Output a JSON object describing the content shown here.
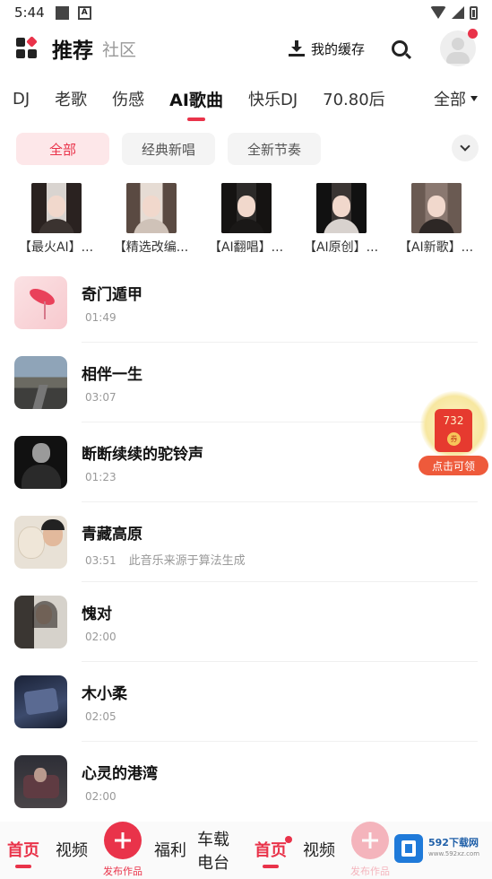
{
  "status_bar": {
    "time": "5:44"
  },
  "header": {
    "title": "推荐",
    "subtitle": "社区",
    "cache_label": "我的缓存"
  },
  "categories": {
    "tabs": [
      {
        "label": "DJ",
        "active": false
      },
      {
        "label": "老歌",
        "active": false
      },
      {
        "label": "伤感",
        "active": false
      },
      {
        "label": "AI歌曲",
        "active": true
      },
      {
        "label": "快乐DJ",
        "active": false
      },
      {
        "label": "70.80后",
        "active": false
      }
    ],
    "all_label": "全部"
  },
  "sub_tabs": [
    {
      "label": "全部",
      "active": true
    },
    {
      "label": "经典新唱",
      "active": false
    },
    {
      "label": "全新节奏",
      "active": false
    }
  ],
  "playlists": [
    {
      "name": "【最火AI】..."
    },
    {
      "name": "【精选改编..."
    },
    {
      "name": "【AI翻唱】..."
    },
    {
      "name": "【AI原创】..."
    },
    {
      "name": "【AI新歌】..."
    }
  ],
  "songs": [
    {
      "title": "奇门遁甲",
      "duration": "01:49",
      "note": ""
    },
    {
      "title": "相伴一生",
      "duration": "03:07",
      "note": ""
    },
    {
      "title": "断断续续的驼铃声",
      "duration": "01:23",
      "note": ""
    },
    {
      "title": "青藏高原",
      "duration": "03:51",
      "note": "此音乐来源于算法生成"
    },
    {
      "title": "愧对",
      "duration": "02:00",
      "note": ""
    },
    {
      "title": "木小柔",
      "duration": "02:05",
      "note": ""
    },
    {
      "title": "心灵的港湾",
      "duration": "02:00",
      "note": ""
    }
  ],
  "float_badge": {
    "amount": "732",
    "coin": "券",
    "label": "点击可领"
  },
  "bottom_nav": {
    "home": "首页",
    "video": "视频",
    "publish": "发布作品",
    "welfare": "福利",
    "car_radio": "车载电台",
    "home2": "首页",
    "video2": "视频",
    "publish2": "发布作品"
  },
  "watermark": {
    "title": "592下载网",
    "url": "www.592xz.com"
  },
  "colors": {
    "accent": "#e9334a",
    "chip_bg": "#f4f4f4",
    "chip_active_bg": "#fde7e9"
  }
}
